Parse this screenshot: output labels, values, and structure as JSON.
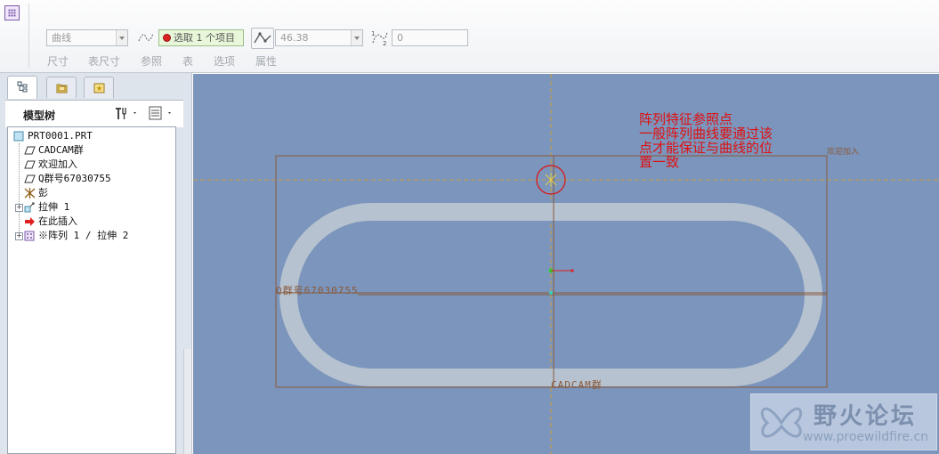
{
  "dashboard": {
    "type_select": "曲线",
    "collector": "选取 1 个项目",
    "angle_value": "46.38",
    "offset_value": "0",
    "tabs": [
      "尺寸",
      "表尺寸",
      "参照",
      "表",
      "选项",
      "属性"
    ]
  },
  "model_tree": {
    "title": "模型树",
    "items": [
      {
        "label": "PRT0001.PRT",
        "icon": "part-icon"
      },
      {
        "label": "CADCAM群",
        "icon": "datum-plane-icon"
      },
      {
        "label": "欢迎加入",
        "icon": "datum-plane-icon"
      },
      {
        "label": "Q群号67030755",
        "icon": "datum-plane-icon"
      },
      {
        "label": "彭",
        "icon": "coordinate-system-icon"
      },
      {
        "label": "拉伸 1",
        "icon": "extrude-icon"
      },
      {
        "label": "在此插入",
        "icon": "insert-here-arrow-icon"
      },
      {
        "label": "※阵列 1 / 拉伸 2",
        "icon": "pattern-icon"
      }
    ]
  },
  "viewport": {
    "annotation": [
      "阵列特征参照点",
      "一般阵列曲线要通过该",
      "点才能保证与曲线的位",
      "置一致"
    ],
    "plane_top_right": "欢迎加入",
    "plane_left": "Q群号67030755",
    "plane_bottom": "CADCAM群"
  },
  "watermark": {
    "title": "野火论坛",
    "url": "www.proewildfire.cn"
  },
  "colors": {
    "viewport_bg": "#7b95bc",
    "annotation": "#e01010",
    "datum": "#8a5a3c"
  }
}
